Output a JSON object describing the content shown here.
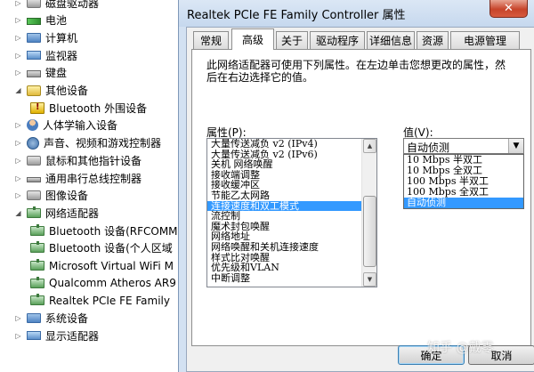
{
  "device_tree": {
    "items": [
      {
        "label": "磁盘驱动器",
        "icon": "disk-drive-icon",
        "arrow": "▷",
        "depth": 0
      },
      {
        "label": "电池",
        "icon": "battery-icon",
        "arrow": "▷",
        "depth": 0
      },
      {
        "label": "计算机",
        "icon": "computer-icon",
        "arrow": "▷",
        "depth": 0
      },
      {
        "label": "监视器",
        "icon": "monitor-icon",
        "arrow": "▷",
        "depth": 0
      },
      {
        "label": "键盘",
        "icon": "keyboard-icon",
        "arrow": "▷",
        "depth": 0
      },
      {
        "label": "其他设备",
        "icon": "other-devices-icon",
        "arrow": "◢",
        "depth": 0
      },
      {
        "label": "Bluetooth 外围设备",
        "icon": "warning-device-icon",
        "arrow": "",
        "depth": 1
      },
      {
        "label": "人体学输入设备",
        "icon": "hid-icon",
        "arrow": "▷",
        "depth": 0
      },
      {
        "label": "声音、视频和游戏控制器",
        "icon": "audio-icon",
        "arrow": "▷",
        "depth": 0
      },
      {
        "label": "鼠标和其他指针设备",
        "icon": "mouse-icon",
        "arrow": "▷",
        "depth": 0
      },
      {
        "label": "通用串行总线控制器",
        "icon": "usb-icon",
        "arrow": "▷",
        "depth": 0
      },
      {
        "label": "图像设备",
        "icon": "imaging-device-icon",
        "arrow": "▷",
        "depth": 0
      },
      {
        "label": "网络适配器",
        "icon": "network-adapter-icon",
        "arrow": "◢",
        "depth": 0
      },
      {
        "label": "Bluetooth 设备(RFCOMM",
        "icon": "network-adapter-icon",
        "arrow": "",
        "depth": 1
      },
      {
        "label": "Bluetooth 设备(个人区域",
        "icon": "network-adapter-icon",
        "arrow": "",
        "depth": 1
      },
      {
        "label": "Microsoft Virtual WiFi M",
        "icon": "network-adapter-icon",
        "arrow": "",
        "depth": 1
      },
      {
        "label": "Qualcomm Atheros AR9",
        "icon": "network-adapter-icon",
        "arrow": "",
        "depth": 1
      },
      {
        "label": "Realtek PCIe FE Family",
        "icon": "network-adapter-icon",
        "arrow": "",
        "depth": 1
      },
      {
        "label": "系统设备",
        "icon": "system-device-icon",
        "arrow": "▷",
        "depth": 0
      },
      {
        "label": "显示适配器",
        "icon": "display-adapter-icon",
        "arrow": "▷",
        "depth": 0
      }
    ]
  },
  "dialog": {
    "title": "Realtek PCIe FE Family Controller 属性",
    "close_glyph": "✕",
    "tabs": [
      {
        "label": "常规",
        "selected": false
      },
      {
        "label": "高级",
        "selected": true
      },
      {
        "label": "关于",
        "selected": false
      },
      {
        "label": "驱动程序",
        "selected": false
      },
      {
        "label": "详细信息",
        "selected": false
      },
      {
        "label": "资源",
        "selected": false
      },
      {
        "label": "电源管理",
        "selected": false
      }
    ],
    "description": "此网络适配器可使用下列属性。在左边单击您想更改的属性，然后在右边选择它的值。",
    "property_label": "属性(P):",
    "properties": [
      "大量传送减负 v2 (IPv4)",
      "大量传送减负 v2 (IPv6)",
      "关机 网络唤醒",
      "接收端调整",
      "接收缓冲区",
      "节能乙太网路",
      "连接速度和双工模式",
      "流控制",
      "魔术封包唤醒",
      "网络地址",
      "网络唤醒和关机连接速度",
      "样式比对唤醒",
      "优先级和VLAN",
      "中断调整"
    ],
    "selected_property": "连接速度和双工模式",
    "value_label": "值(V):",
    "current_value": "自动侦测",
    "value_options": [
      "10 Mbps 半双工",
      "10 Mbps 全双工",
      "100 Mbps 半双工",
      "100 Mbps 全双工",
      "自动侦测"
    ],
    "selected_value": "自动侦测",
    "ok_label": "确定",
    "cancel_label": "取消"
  },
  "watermark": "知乎 @戴零"
}
